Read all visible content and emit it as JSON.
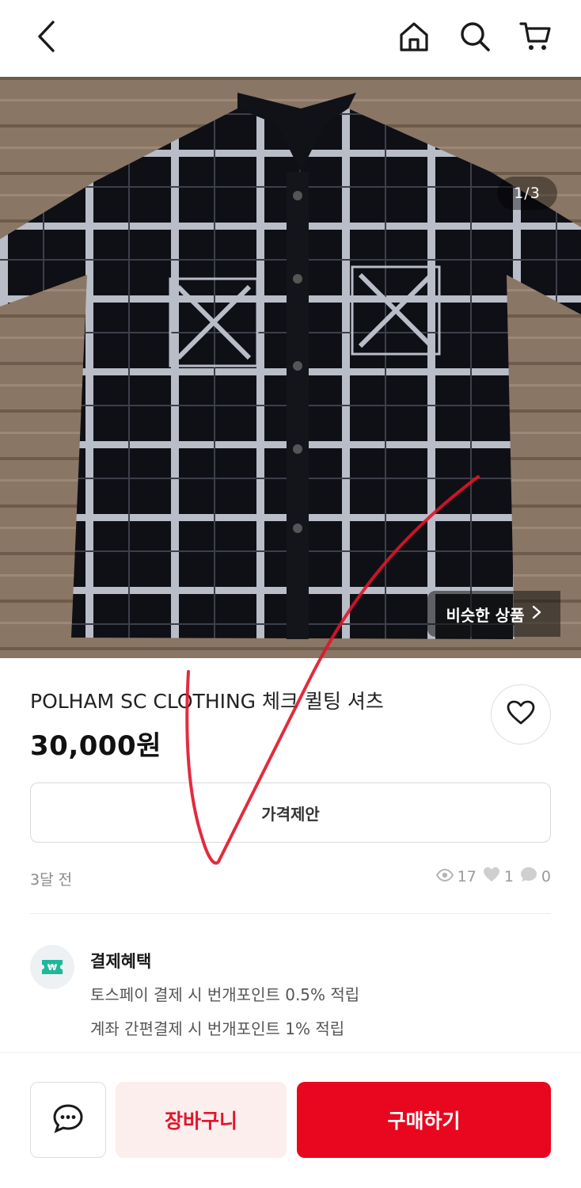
{
  "header": {
    "back_icon": "chevron-left-icon",
    "home_icon": "home-icon",
    "search_icon": "search-icon",
    "cart_icon": "cart-icon"
  },
  "gallery": {
    "counter": "1/3",
    "similar_label": "비슷한 상품",
    "similar_icon": "chevron-right-icon"
  },
  "product": {
    "title": "POLHAM SC CLOTHING 체크 퀼팅 셔츠",
    "price": "30,000원",
    "like_icon": "heart-icon"
  },
  "offer": {
    "label": "가격제안"
  },
  "meta": {
    "posted": "3달 전",
    "views": "17",
    "likes": "1",
    "chats": "0"
  },
  "benefits": {
    "title": "결제혜택",
    "line1": "토스페이 결제 시 번개포인트 0.5% 적립",
    "line2": "계좌 간편결제 시 번개포인트 1% 적립",
    "icon": "won-coupon-icon"
  },
  "actions": {
    "chat_icon": "chat-bubble-icon",
    "cart_label": "장바구니",
    "buy_label": "구매하기"
  },
  "colors": {
    "accent": "#e8071f",
    "cart_bg": "#fdeeee",
    "mint": "#1fb89b"
  }
}
